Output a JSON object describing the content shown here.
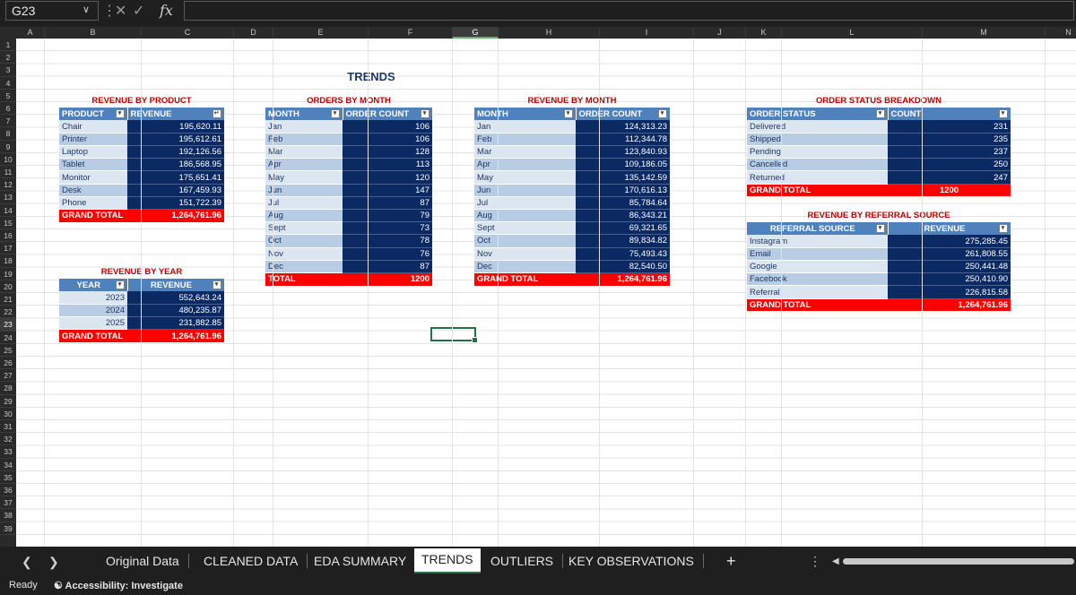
{
  "formula_bar": {
    "name_box": "G23",
    "fx_label": "fx",
    "formula": ""
  },
  "grid": {
    "columns": [
      "A",
      "B",
      "C",
      "D",
      "E",
      "F",
      "G",
      "H",
      "I",
      "J",
      "K",
      "L",
      "M",
      "N"
    ],
    "selected_column": "G",
    "rows": [
      "1",
      "2",
      "3",
      "4",
      "5",
      "6",
      "7",
      "8",
      "9",
      "10",
      "11",
      "12",
      "13",
      "14",
      "15",
      "16",
      "17",
      "18",
      "19",
      "20",
      "21",
      "22",
      "23",
      "24",
      "25",
      "26",
      "27",
      "28",
      "29",
      "30",
      "31",
      "32",
      "33",
      "34",
      "35",
      "36",
      "37",
      "38",
      "39"
    ],
    "selected_row": "23"
  },
  "page_title": "TRENDS",
  "revenue_by_product": {
    "title": "REVENUE BY PRODUCT",
    "headers": [
      "PRODUCT",
      "REVENUE"
    ],
    "rows": [
      [
        "Chair",
        "195,620.11"
      ],
      [
        "Printer",
        "195,612.61"
      ],
      [
        "Laptop",
        "192,126.56"
      ],
      [
        "Tablet",
        "186,568.95"
      ],
      [
        "Monitor",
        "175,651.41"
      ],
      [
        "Desk",
        "167,459.93"
      ],
      [
        "Phone",
        "151,722.39"
      ]
    ],
    "total": [
      "GRAND TOTAL",
      "1,264,761.96"
    ]
  },
  "revenue_by_year": {
    "title": "REVENUE BY YEAR",
    "headers": [
      "YEAR",
      "REVENUE"
    ],
    "rows": [
      [
        "2023",
        "552,643.24"
      ],
      [
        "2024",
        "480,235.87"
      ],
      [
        "2025",
        "231,882.85"
      ]
    ],
    "total": [
      "GRAND TOTAL",
      "1,264,761.96"
    ]
  },
  "orders_by_month": {
    "title": "ORDERS BY MONTH",
    "headers": [
      "MONTH",
      "ORDER COUNT"
    ],
    "rows": [
      [
        "Jan",
        "106"
      ],
      [
        "Feb",
        "106"
      ],
      [
        "Mar",
        "128"
      ],
      [
        "Apr",
        "113"
      ],
      [
        "May",
        "120"
      ],
      [
        "Jun",
        "147"
      ],
      [
        "Jul",
        "87"
      ],
      [
        "Aug",
        "79"
      ],
      [
        "Sept",
        "73"
      ],
      [
        "Oct",
        "78"
      ],
      [
        "Nov",
        "76"
      ],
      [
        "Dec",
        "87"
      ]
    ],
    "total": [
      "TOTAL",
      "1200"
    ]
  },
  "revenue_by_month": {
    "title": "REVENUE  BY MONTH",
    "headers": [
      "MONTH",
      "ORDER COUNT"
    ],
    "rows": [
      [
        "Jan",
        "124,313.23"
      ],
      [
        "Feb",
        "112,344.78"
      ],
      [
        "Mar",
        "123,840.93"
      ],
      [
        "Apr",
        "109,186.05"
      ],
      [
        "May",
        "135,142.59"
      ],
      [
        "Jun",
        "170,616.13"
      ],
      [
        "Jul",
        "85,784.64"
      ],
      [
        "Aug",
        "86,343.21"
      ],
      [
        "Sept",
        "69,321.65"
      ],
      [
        "Oct",
        "89,834.82"
      ],
      [
        "Nov",
        "75,493.43"
      ],
      [
        "Dec",
        "82,540.50"
      ]
    ],
    "total": [
      "GRAND TOTAL",
      "1,264,761.96"
    ]
  },
  "order_status": {
    "title": "ORDER STATUS BREAKDOWN",
    "headers": [
      "ORDER STATUS",
      "COUNT"
    ],
    "rows": [
      [
        "Delivered",
        "231"
      ],
      [
        "Shipped",
        "235"
      ],
      [
        "Pending",
        "237"
      ],
      [
        "Cancelled",
        "250"
      ],
      [
        "Returned",
        "247"
      ]
    ],
    "total": [
      "GRAND TOTAL",
      "1200"
    ]
  },
  "revenue_by_referral": {
    "title": "REVENUE BY REFERRAL SOURCE",
    "headers": [
      "REFERRAL SOURCE",
      "REVENUE"
    ],
    "rows": [
      [
        "Instagram",
        "275,285.45"
      ],
      [
        "Email",
        "261,808.55"
      ],
      [
        "Google",
        "250,441.48"
      ],
      [
        "Facebook",
        "250,410.90"
      ],
      [
        "Referral",
        "226,815.58"
      ]
    ],
    "total": [
      "GRAND TOTAL",
      "1,264,761.96"
    ]
  },
  "sheet_tabs": [
    "Original Data",
    "CLEANED DATA",
    "EDA SUMMARY",
    "TRENDS",
    "OUTLIERS",
    "KEY OBSERVATIONS"
  ],
  "active_tab": "TRENDS",
  "status": {
    "ready": "Ready",
    "accessibility": "Accessibility: Investigate"
  },
  "colors": {
    "header_blue": "#4f81bd",
    "value_navy": "#0b2a64",
    "label_light": "#dce6f1",
    "total_red": "#ff0000",
    "title_red": "#c00000",
    "selection_green": "#217346"
  }
}
